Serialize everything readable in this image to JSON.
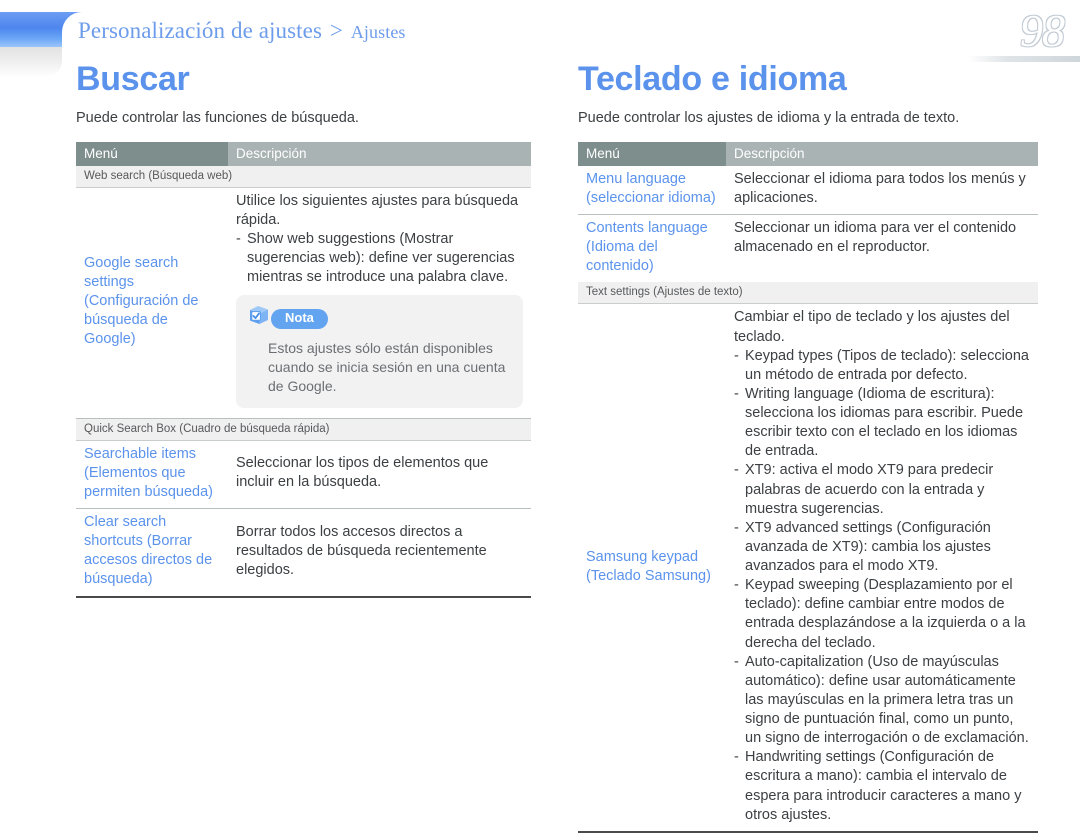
{
  "header": {
    "breadcrumb_main": "Personalización de ajustes",
    "breadcrumb_separator": ">",
    "breadcrumb_sub": "Ajustes",
    "page_number": "98",
    "accent_blue": "#5b93ec",
    "header_menu_bg": "#7e8e8d",
    "header_desc_bg": "#a9b3b3"
  },
  "left": {
    "title": "Buscar",
    "subtitle": "Puede controlar las funciones de búsqueda.",
    "table": {
      "columns": [
        "Menú",
        "Descripción"
      ],
      "sections": [
        {
          "label": "Web search (Búsqueda web)",
          "rows": [
            {
              "menu": "Google search settings (Configuración de búsqueda de Google)",
              "desc_paragraph": "Utilice los siguientes ajustes para búsqueda rápida.",
              "desc_bullets": [
                "Show web suggestions (Mostrar sugerencias web): define ver sugerencias mientras se introduce una palabra clave."
              ],
              "note": {
                "icon": "cube-check-icon",
                "label": "Nota",
                "text": "Estos ajustes sólo están disponibles cuando se inicia sesión en una cuenta de Google."
              }
            }
          ]
        },
        {
          "label": "Quick Search Box (Cuadro de búsqueda rápida)",
          "rows": [
            {
              "menu": "Searchable items (Elementos que permiten búsqueda)",
              "desc_paragraph": "Seleccionar los tipos de elementos que incluir en la búsqueda.",
              "desc_bullets": []
            },
            {
              "menu": "Clear search shortcuts (Borrar accesos directos de búsqueda)",
              "desc_paragraph": "Borrar todos los accesos directos a resultados de búsqueda recientemente elegidos.",
              "desc_bullets": []
            }
          ]
        }
      ]
    }
  },
  "right": {
    "title": "Teclado e idioma",
    "subtitle": "Puede controlar los ajustes de idioma y la entrada de texto.",
    "table": {
      "columns": [
        "Menú",
        "Descripción"
      ],
      "plain_rows": [
        {
          "menu": "Menu language (seleccionar idioma)",
          "desc_paragraph": "Seleccionar el idioma para todos los menús y aplicaciones."
        },
        {
          "menu": "Contents language (Idioma del contenido)",
          "desc_paragraph": "Seleccionar un idioma para ver el contenido almacenado en el reproductor."
        }
      ],
      "sections": [
        {
          "label": "Text settings (Ajustes de texto)",
          "rows": [
            {
              "menu": "Samsung keypad (Teclado Samsung)",
              "desc_paragraph": "Cambiar el tipo de teclado y los ajustes del teclado.",
              "desc_bullets": [
                "Keypad types (Tipos de teclado): selecciona un método de entrada por defecto.",
                "Writing language (Idioma de escritura): selecciona los idiomas para escribir. Puede escribir texto con el teclado en los idiomas de entrada.",
                "XT9: activa el modo XT9 para predecir palabras de acuerdo con la entrada y muestra sugerencias.",
                "XT9 advanced settings (Configuración avanzada de XT9): cambia los ajustes avanzados para el modo XT9.",
                "Keypad sweeping (Desplazamiento por el teclado): define cambiar entre modos de entrada desplazándose a la izquierda o a la derecha del teclado.",
                "Auto-capitalization (Uso de mayúsculas automático): define usar automáticamente las mayúsculas en la primera letra tras un signo de puntuación final, como un punto, un signo de interrogación o de exclamación.",
                "Handwriting settings (Configuración de escritura a mano): cambia el intervalo de espera para introducir caracteres a mano y otros ajustes."
              ]
            }
          ]
        }
      ]
    }
  }
}
